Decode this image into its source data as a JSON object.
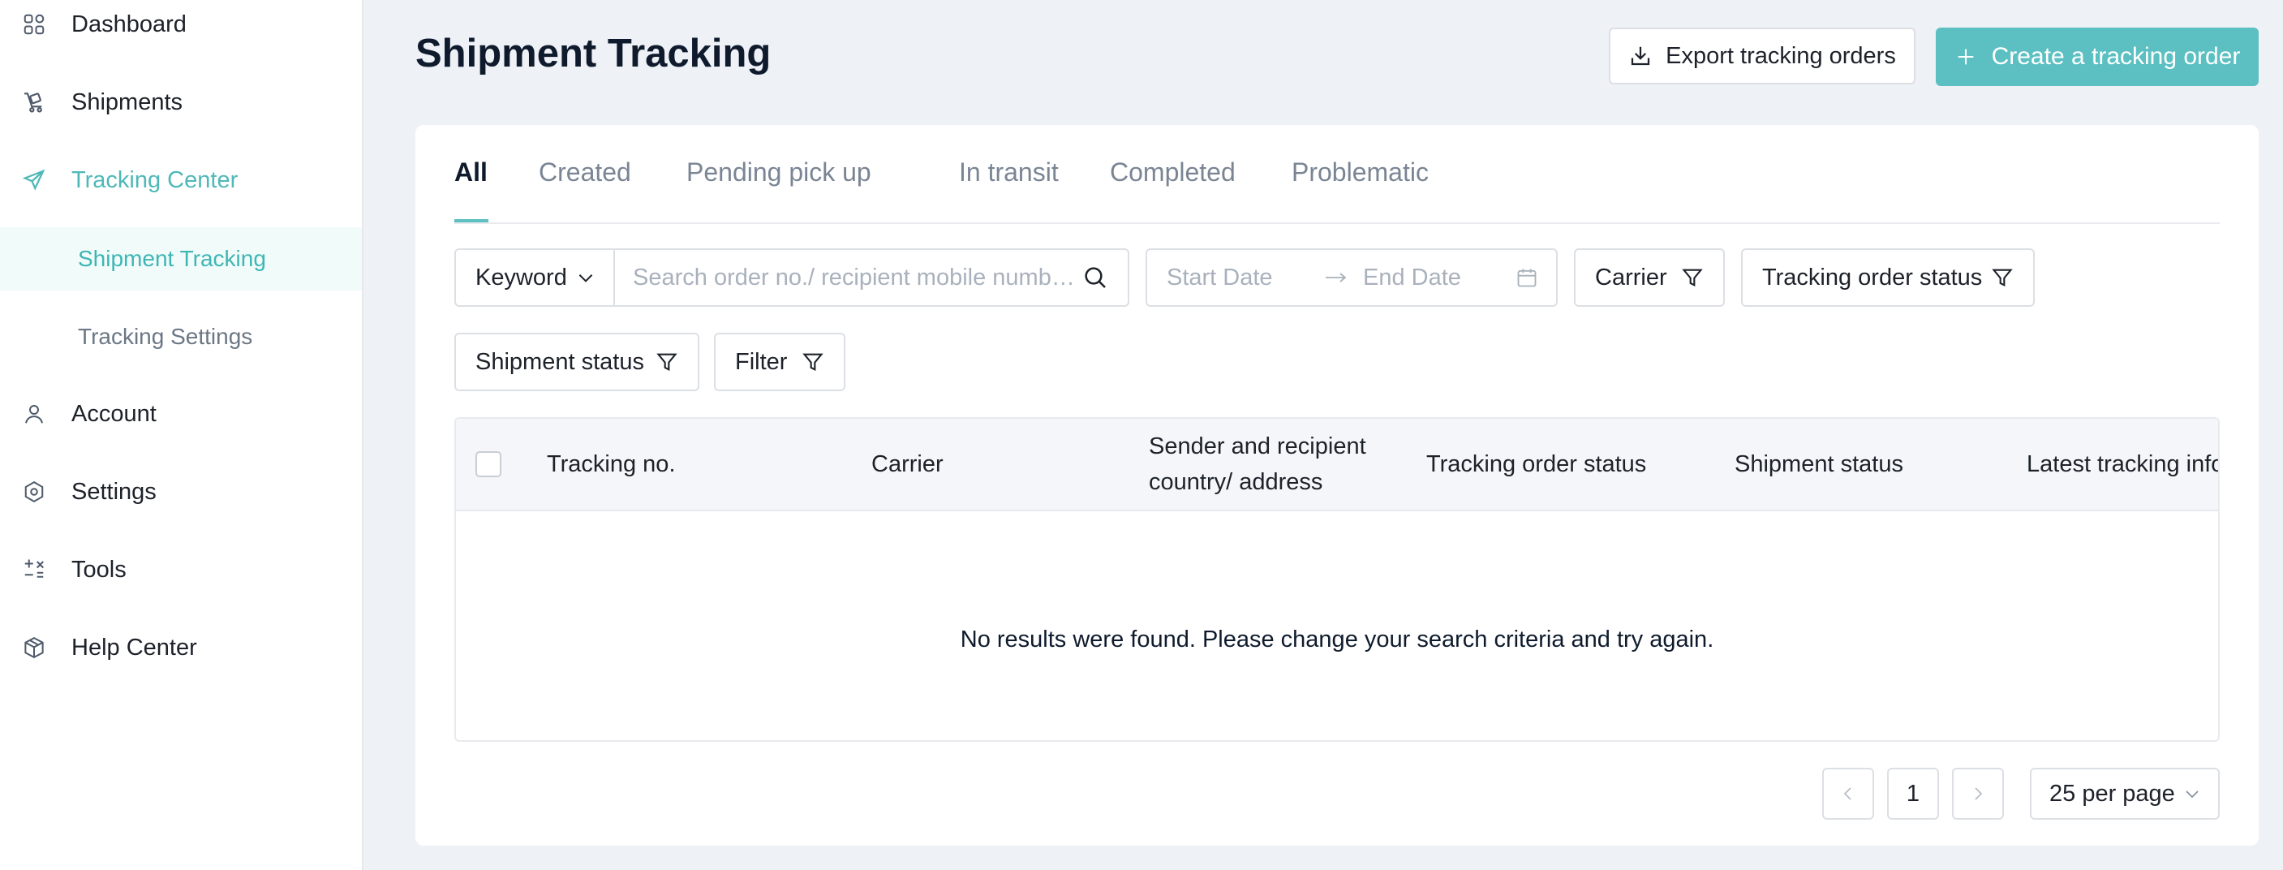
{
  "sidebar": {
    "items": [
      {
        "label": "Dashboard",
        "icon": "dashboard-icon"
      },
      {
        "label": "Shipments",
        "icon": "shipments-icon"
      },
      {
        "label": "Tracking Center",
        "icon": "send-icon"
      },
      {
        "label": "Account",
        "icon": "user-icon"
      },
      {
        "label": "Settings",
        "icon": "settings-icon"
      },
      {
        "label": "Tools",
        "icon": "tools-icon"
      },
      {
        "label": "Help Center",
        "icon": "package-icon"
      }
    ],
    "sub_items": [
      {
        "label": "Shipment Tracking",
        "selected": true
      },
      {
        "label": "Tracking Settings",
        "selected": false
      }
    ]
  },
  "header": {
    "title": "Shipment Tracking",
    "export_label": "Export tracking orders",
    "create_label": "Create a tracking order"
  },
  "tabs": [
    "All",
    "Created",
    "Pending pick up",
    "In transit",
    "Completed",
    "Problematic"
  ],
  "filters": {
    "keyword_label": "Keyword",
    "search_placeholder": "Search order no./ recipient mobile numb…",
    "start_date_placeholder": "Start Date",
    "end_date_placeholder": "End Date",
    "carrier_label": "Carrier",
    "tracking_status_label": "Tracking order status",
    "shipment_status_label": "Shipment status",
    "filter_label": "Filter"
  },
  "table": {
    "columns": [
      "Tracking no.",
      "Carrier",
      "Sender and recipient country/ address",
      "Tracking order status",
      "Shipment status",
      "Latest tracking info"
    ],
    "empty_message": "No results were found. Please change your search criteria and try again."
  },
  "pagination": {
    "current_page": "1",
    "per_page": "25 per page"
  },
  "colors": {
    "accent": "#5cc0c2",
    "active_text": "#3fb6b4",
    "background": "#eef1f6"
  }
}
